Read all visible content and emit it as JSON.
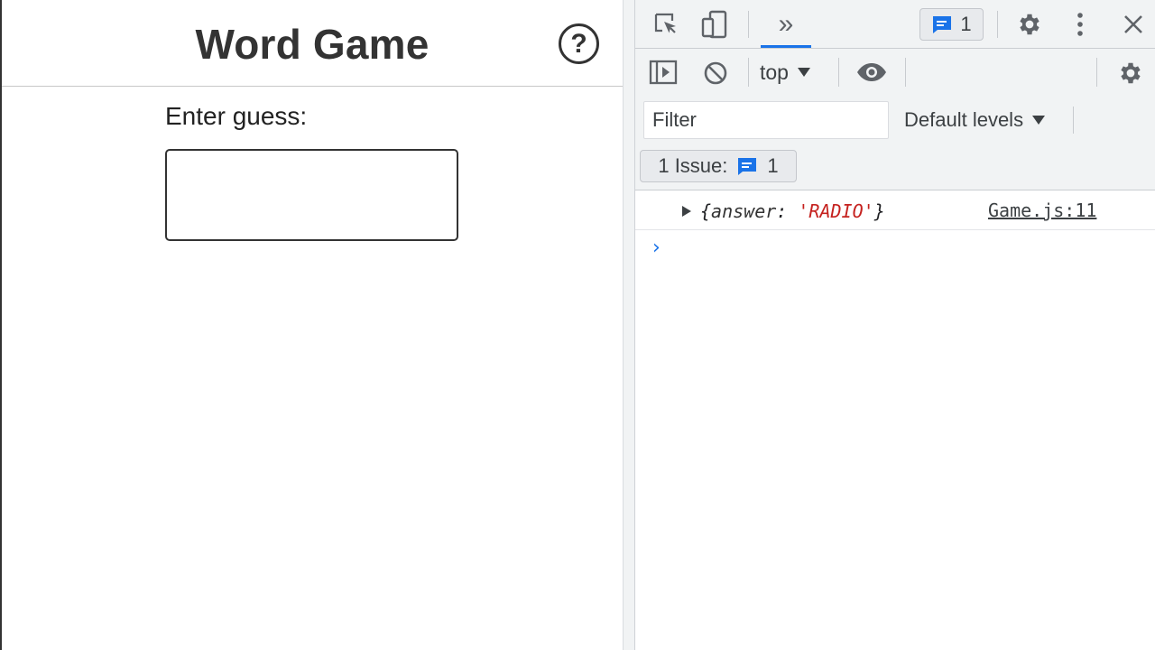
{
  "app": {
    "title": "Word Game",
    "help_symbol": "?",
    "guess_label": "Enter guess:",
    "guess_value": ""
  },
  "devtools": {
    "tabs": {
      "more_symbol": "»"
    },
    "issues_badge": {
      "count": "1"
    },
    "console_toolbar": {
      "context": "top",
      "filter_placeholder": "Filter",
      "levels": "Default levels"
    },
    "issues_bar": {
      "label": "1 Issue:",
      "count": "1"
    },
    "console": {
      "messages": [
        {
          "open_brace": "{",
          "key": "answer",
          "colon": ": ",
          "value": "'RADIO'",
          "close_brace": "}",
          "source": "Game.js:11"
        }
      ],
      "prompt_symbol": "›"
    },
    "colors": {
      "accent": "#1a73e8",
      "string_value": "#c5221f",
      "toolbar_bg": "#f1f3f4"
    }
  }
}
